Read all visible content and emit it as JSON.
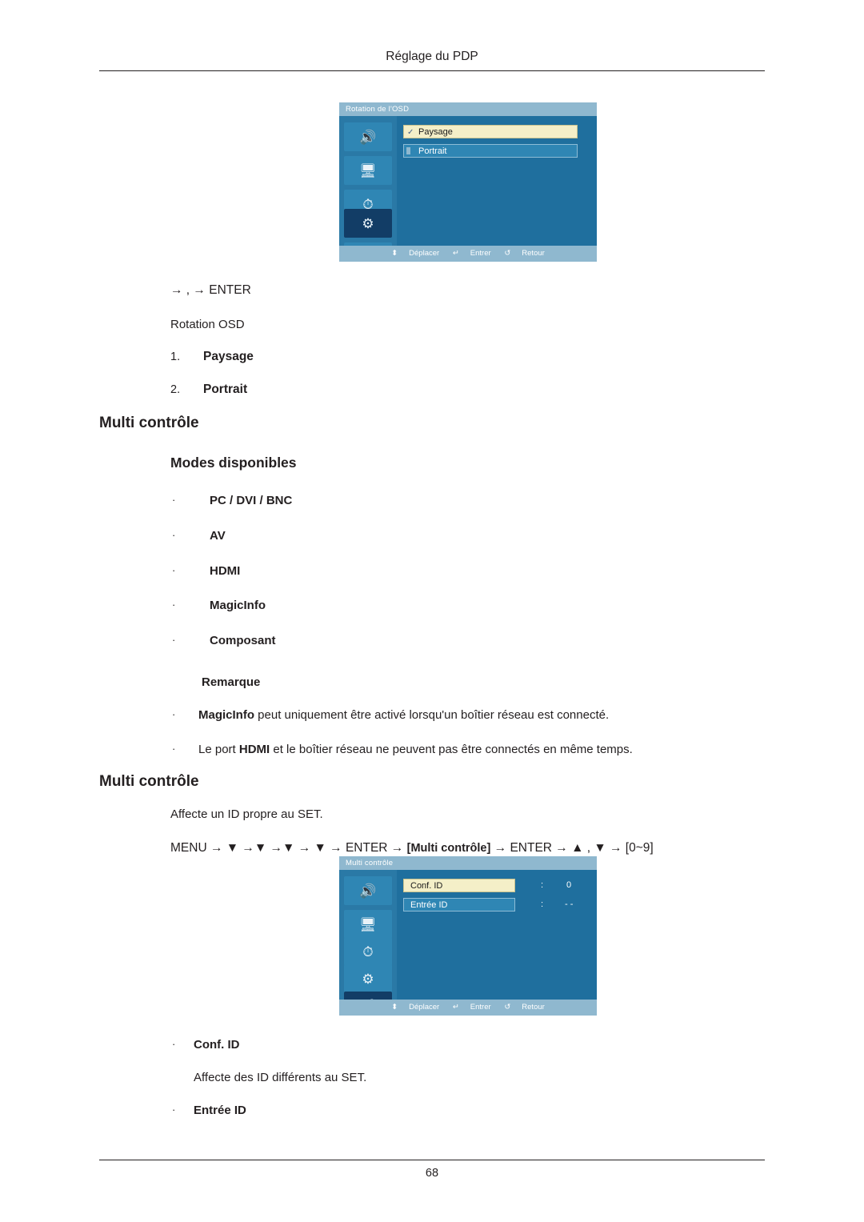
{
  "header": {
    "title": "Réglage du PDP"
  },
  "footer": {
    "page_number": "68"
  },
  "osd_top": {
    "title": "Rotation de l'OSD",
    "items": [
      {
        "label": "Paysage",
        "selected": true,
        "check": "✓"
      },
      {
        "label": "Portrait",
        "selected": false
      }
    ],
    "sidebar_icons": [
      "sound-icon",
      "input-icon",
      "time-icon",
      "setup-gear-icon",
      "multicontrol-icon"
    ],
    "bottom": {
      "move_icon": "⬍",
      "move": "Déplacer",
      "enter_icon": "↵",
      "enter": "Entrer",
      "return_icon": "↺",
      "return": "Retour"
    }
  },
  "section1": {
    "sequence": "→  ,   → ENTER",
    "title": "Rotation OSD",
    "items": [
      {
        "num": "1.",
        "label": "Paysage"
      },
      {
        "num": "2.",
        "label": "Portrait"
      }
    ]
  },
  "multi_control_1": {
    "heading": "Multi contrôle",
    "sub_heading": "Modes disponibles",
    "modes": [
      "PC / DVI / BNC",
      "AV",
      "HDMI",
      "MagicInfo",
      "Composant"
    ],
    "remark_title": "Remarque",
    "remarks": [
      {
        "bold": "MagicInfo",
        "rest": " peut uniquement être activé lorsqu'un boîtier réseau est connecté."
      },
      {
        "pre": "Le port ",
        "bold": "HDMI",
        "rest": " et le boîtier réseau ne peuvent pas être connectés en même temps."
      }
    ]
  },
  "multi_control_2": {
    "heading": "Multi contrôle",
    "desc": "Affecte un ID propre au SET.",
    "sequence_prefix": "MENU → ▼ →▼ →▼ → ▼ → ENTER → ",
    "sequence_tag": "[Multi contrôle]",
    "sequence_suffix": " → ENTER → ▲ , ▼ → [0~9]",
    "items": [
      {
        "label": "Conf. ID",
        "desc": "Affecte des ID différents au SET."
      },
      {
        "label": "Entrée ID",
        "desc": ""
      }
    ]
  },
  "osd_bottom": {
    "title": "Multi contrôle",
    "rows": [
      {
        "label": "Conf. ID",
        "selected": true,
        "sep": ":",
        "value": "0"
      },
      {
        "label": "Entrée ID",
        "selected": false,
        "sep": ":",
        "value": "- -"
      }
    ],
    "sidebar_icons": [
      "sound-icon",
      "input-icon",
      "time-icon",
      "setup-gear-icon",
      "multicontrol-icon"
    ],
    "bottom": {
      "move_icon": "⬍",
      "move": "Déplacer",
      "enter_icon": "↵",
      "enter": "Entrer",
      "return_icon": "↺",
      "return": "Retour"
    }
  }
}
